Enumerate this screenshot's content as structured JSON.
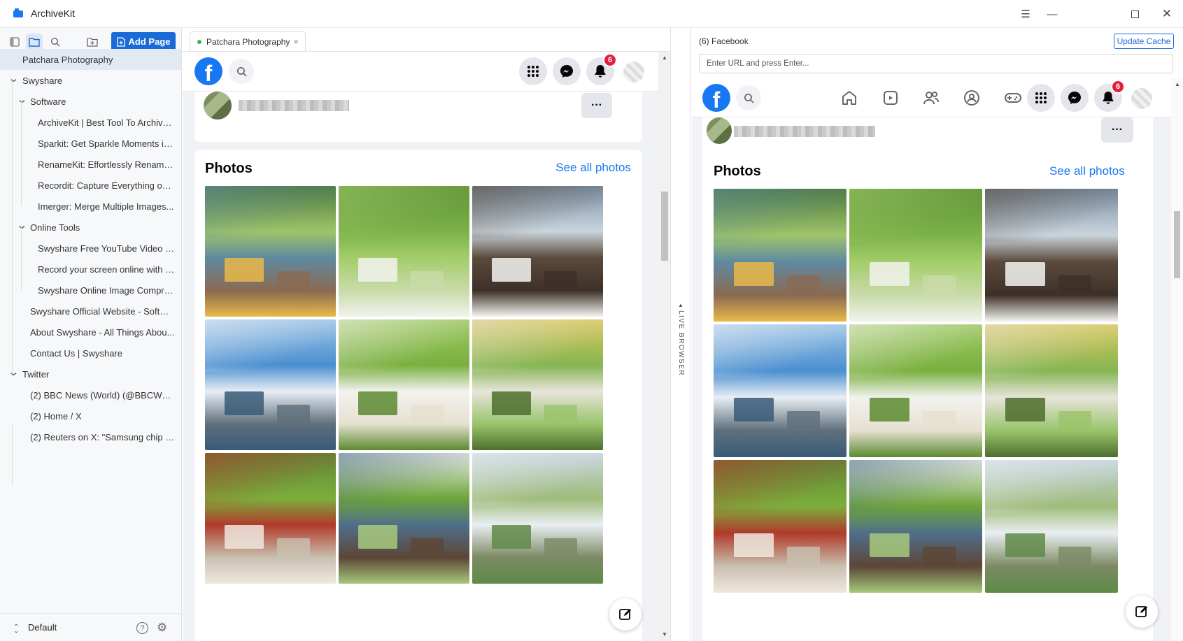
{
  "app": {
    "title": "ArchiveKit"
  },
  "sidebar": {
    "add_page_label": "Add Page",
    "tree": [
      {
        "label": "Patchara Photography",
        "level": 0,
        "chevron": false,
        "selected": true
      },
      {
        "label": "Swyshare",
        "level": 0,
        "chevron": true
      },
      {
        "label": "Software",
        "level": 1,
        "chevron": true
      },
      {
        "label": "ArchiveKit | Best Tool To Archive ...",
        "level": 2,
        "chevron": false
      },
      {
        "label": "Sparkit: Get Sparkle Moments in...",
        "level": 2,
        "chevron": false
      },
      {
        "label": "RenameKit: Effortlessly Rename ...",
        "level": 2,
        "chevron": false
      },
      {
        "label": "Recordit: Capture Everything on ...",
        "level": 2,
        "chevron": false
      },
      {
        "label": "Imerger: Merge Multiple Images...",
        "level": 2,
        "chevron": false
      },
      {
        "label": "Online Tools",
        "level": 1,
        "chevron": true
      },
      {
        "label": "Swyshare Free YouTube Video S...",
        "level": 2,
        "chevron": false
      },
      {
        "label": "Record your screen online with S...",
        "level": 2,
        "chevron": false
      },
      {
        "label": "Swyshare Online Image Compre...",
        "level": 2,
        "chevron": false
      },
      {
        "label": "Swyshare Official Website - Softwa...",
        "level": 1,
        "chevron": false
      },
      {
        "label": "About Swyshare - All Things Abou...",
        "level": 1,
        "chevron": false
      },
      {
        "label": "Contact Us | Swyshare",
        "level": 1,
        "chevron": false
      },
      {
        "label": "Twitter",
        "level": 0,
        "chevron": true
      },
      {
        "label": "(2) BBC News (World) (@BBCWorl...",
        "level": 1,
        "chevron": false
      },
      {
        "label": "(2) Home / X",
        "level": 1,
        "chevron": false
      },
      {
        "label": "(2) Reuters on X: \"Samsung chip p...",
        "level": 1,
        "chevron": false
      }
    ],
    "workspace_label": "Default"
  },
  "tab": {
    "label": "Patchara Photography"
  },
  "archived": {
    "notification_count": "6",
    "facebook_letter": "f",
    "photos_title": "Photos",
    "see_all": "See all photos",
    "more": "···"
  },
  "live_browser": {
    "label": "LIVE BROWSER",
    "page_title": "(6) Facebook",
    "update_cache_label": "Update Cache",
    "url_placeholder": "Enter URL and press Enter...",
    "notification_count": "6",
    "facebook_letter": "f",
    "photos_title": "Photos",
    "see_all": "See all photos",
    "more": "···"
  },
  "photos": [
    {
      "name": "lake-village",
      "colors": [
        "#9fc46a",
        "#5f8aa0",
        "#e9b949",
        "#4d7a3a",
        "#8a6a52"
      ]
    },
    {
      "name": "green-hills-farm",
      "colors": [
        "#7db24a",
        "#a3cd6a",
        "#f2f2ee",
        "#5c8f34",
        "#c9dba9"
      ]
    },
    {
      "name": "alpine-chalets",
      "colors": [
        "#c9d4dc",
        "#5b4a3c",
        "#f4f4f2",
        "#7b92a7",
        "#3d3028"
      ]
    },
    {
      "name": "matterhorn-lake",
      "colors": [
        "#4a8fd0",
        "#e8eef4",
        "#3a5a78",
        "#9cc3e6",
        "#5f6f7c"
      ]
    },
    {
      "name": "village-pasture",
      "colors": [
        "#7ab040",
        "#f2f2ee",
        "#5c8a30",
        "#9cc760",
        "#e6e0d0"
      ]
    },
    {
      "name": "church-village",
      "colors": [
        "#85b552",
        "#e8e4da",
        "#4c6e2c",
        "#d9c85c",
        "#9ac46c"
      ]
    },
    {
      "name": "red-train-village",
      "colors": [
        "#7cae3c",
        "#b03a2a",
        "#efe8de",
        "#5f8a38",
        "#c9c0b0"
      ]
    },
    {
      "name": "valley-chalets",
      "colors": [
        "#6da43a",
        "#4f6f8a",
        "#a7c97c",
        "#eef0ea",
        "#5c4636"
      ]
    },
    {
      "name": "church-spire-valley",
      "colors": [
        "#9fbc7a",
        "#e9eef2",
        "#5f8a48",
        "#c4d3dc",
        "#7c8a64"
      ]
    }
  ]
}
